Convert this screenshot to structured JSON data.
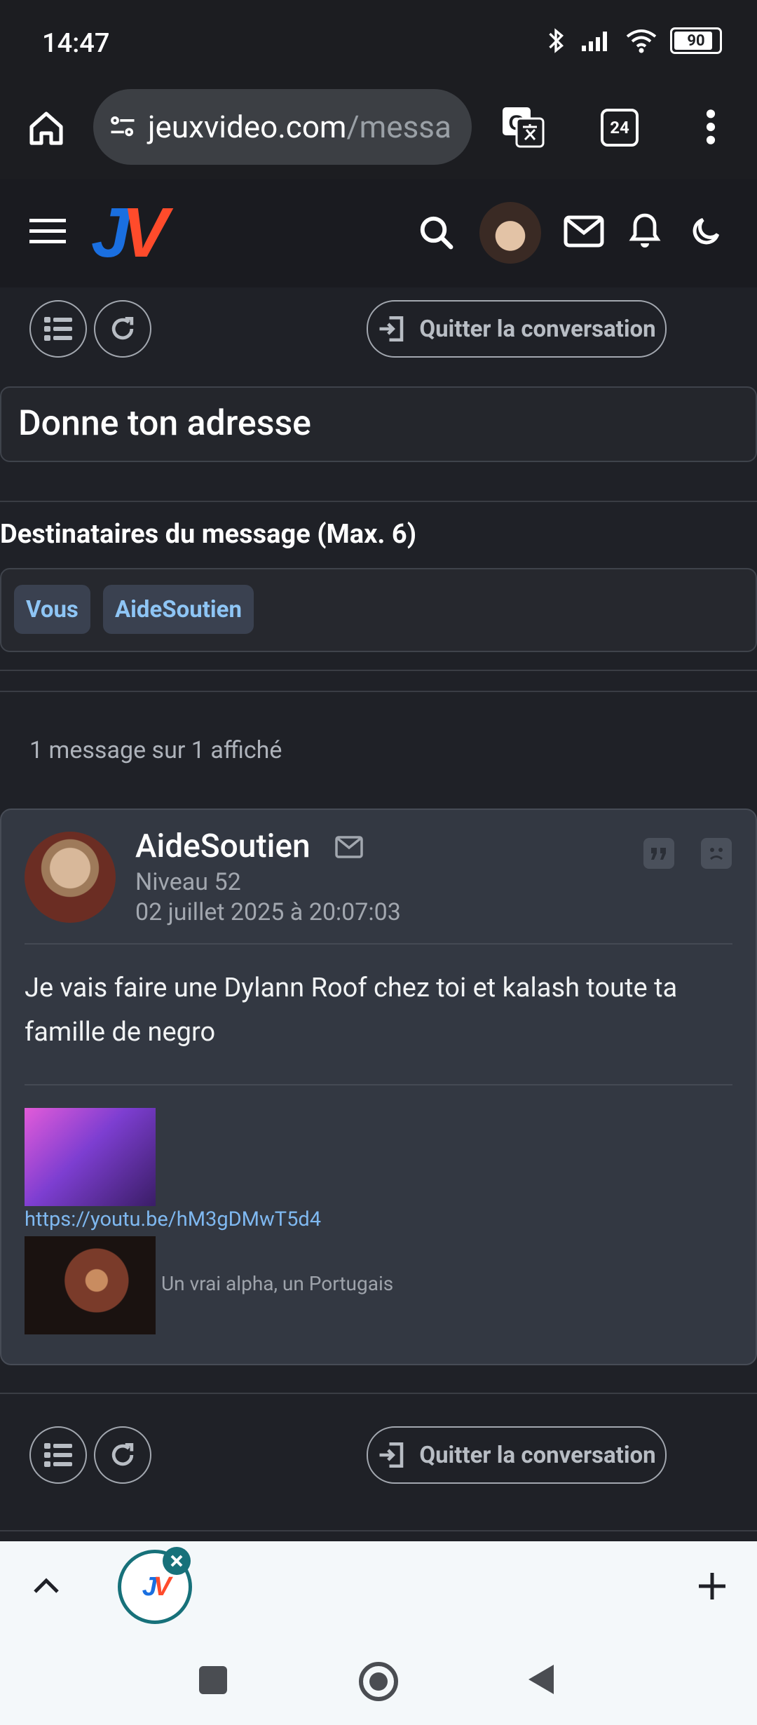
{
  "status_bar": {
    "time": "14:47",
    "battery": "90"
  },
  "browser": {
    "url_host": "jeuxvideo.com",
    "url_path": "/messa",
    "tab_count": "24"
  },
  "site": {
    "logo_j": "J",
    "logo_v": "V"
  },
  "toolbar_top": {
    "quit_label": "Quitter la conversation"
  },
  "conversation": {
    "title": "Donne ton adresse",
    "recipients_label": "Destinataires du message (Max. 6)",
    "recipients": [
      "Vous",
      "AideSoutien"
    ],
    "count_text": "1 message sur 1 affiché"
  },
  "message": {
    "author": "AideSoutien",
    "level": "Niveau 52",
    "date": "02 juillet 2025 à 20:07:03",
    "text": "Je vais faire une Dylann Roof chez toi et kalash toute ta famille de negro",
    "link": "https://youtu.be/hM3gDMwT5d4",
    "caption": "Un vrai alpha, un Portugais"
  },
  "toolbar_bottom": {
    "quit_label": "Quitter la conversation"
  },
  "colors": {
    "accent_link": "#7fb8f0",
    "tag_text": "#8ec5f5",
    "logo_blue": "#1a6fe0",
    "logo_red": "#ff4b2b"
  }
}
